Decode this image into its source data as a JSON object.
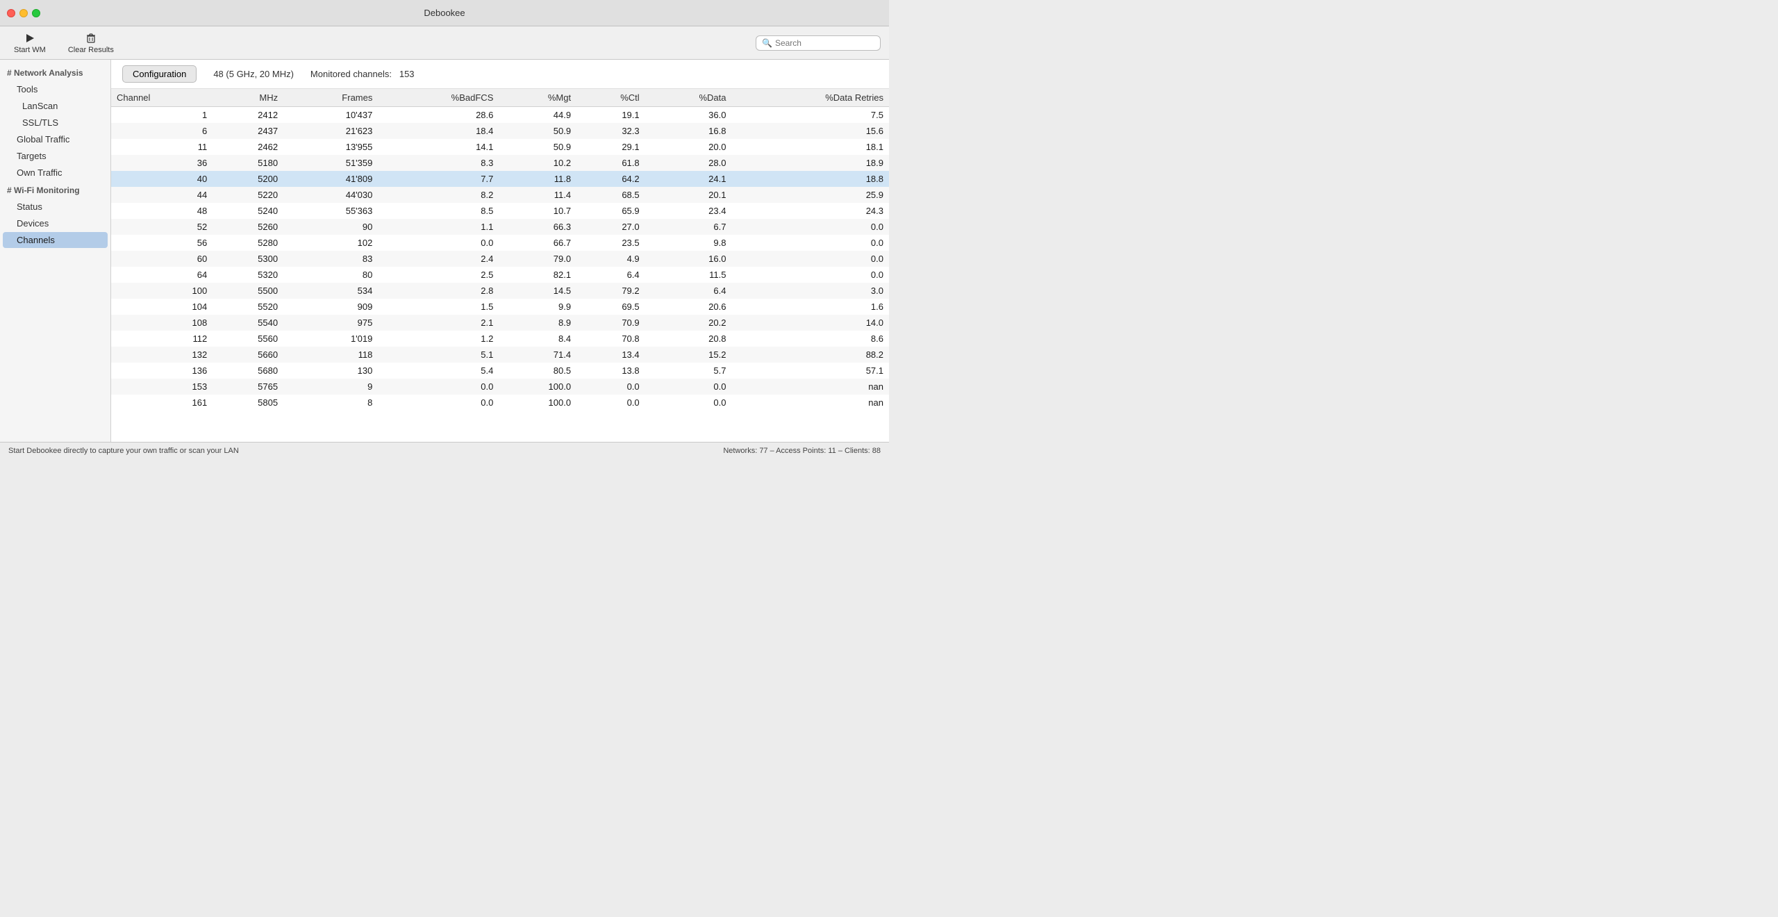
{
  "titlebar": {
    "title": "Debookee"
  },
  "toolbar": {
    "start_wm_label": "Start WM",
    "clear_results_label": "Clear Results",
    "search_placeholder": "Search"
  },
  "sidebar": {
    "network_analysis_header": "# Network Analysis",
    "tools_label": "Tools",
    "lanscan_label": "LanScan",
    "ssltls_label": "SSL/TLS",
    "global_traffic_label": "Global Traffic",
    "targets_label": "Targets",
    "own_traffic_label": "Own Traffic",
    "wifi_monitoring_header": "# Wi-Fi Monitoring",
    "status_label": "Status",
    "devices_label": "Devices",
    "channels_label": "Channels"
  },
  "content": {
    "config_btn": "Configuration",
    "channel_info": "48 (5 GHz, 20 MHz)",
    "monitored_label": "Monitored channels:",
    "monitored_value": "153"
  },
  "table": {
    "headers": [
      "Channel",
      "MHz",
      "Frames",
      "%BadFCS",
      "%Mgt",
      "%Ctl",
      "%Data",
      "%Data Retries"
    ],
    "rows": [
      {
        "channel": 1,
        "mhz": 2412,
        "frames": "10'437",
        "badFCS": "28.6",
        "mgt": "44.9",
        "ctl": "19.1",
        "data": "36.0",
        "dataRetries": "7.5",
        "highlighted": false
      },
      {
        "channel": 6,
        "mhz": 2437,
        "frames": "21'623",
        "badFCS": "18.4",
        "mgt": "50.9",
        "ctl": "32.3",
        "data": "16.8",
        "dataRetries": "15.6",
        "highlighted": false
      },
      {
        "channel": 11,
        "mhz": 2462,
        "frames": "13'955",
        "badFCS": "14.1",
        "mgt": "50.9",
        "ctl": "29.1",
        "data": "20.0",
        "dataRetries": "18.1",
        "highlighted": false
      },
      {
        "channel": 36,
        "mhz": 5180,
        "frames": "51'359",
        "badFCS": "8.3",
        "mgt": "10.2",
        "ctl": "61.8",
        "data": "28.0",
        "dataRetries": "18.9",
        "highlighted": false
      },
      {
        "channel": 40,
        "mhz": 5200,
        "frames": "41'809",
        "badFCS": "7.7",
        "mgt": "11.8",
        "ctl": "64.2",
        "data": "24.1",
        "dataRetries": "18.8",
        "highlighted": true
      },
      {
        "channel": 44,
        "mhz": 5220,
        "frames": "44'030",
        "badFCS": "8.2",
        "mgt": "11.4",
        "ctl": "68.5",
        "data": "20.1",
        "dataRetries": "25.9",
        "highlighted": false
      },
      {
        "channel": 48,
        "mhz": 5240,
        "frames": "55'363",
        "badFCS": "8.5",
        "mgt": "10.7",
        "ctl": "65.9",
        "data": "23.4",
        "dataRetries": "24.3",
        "highlighted": false
      },
      {
        "channel": 52,
        "mhz": 5260,
        "frames": "90",
        "badFCS": "1.1",
        "mgt": "66.3",
        "ctl": "27.0",
        "data": "6.7",
        "dataRetries": "0.0",
        "highlighted": false
      },
      {
        "channel": 56,
        "mhz": 5280,
        "frames": "102",
        "badFCS": "0.0",
        "mgt": "66.7",
        "ctl": "23.5",
        "data": "9.8",
        "dataRetries": "0.0",
        "highlighted": false
      },
      {
        "channel": 60,
        "mhz": 5300,
        "frames": "83",
        "badFCS": "2.4",
        "mgt": "79.0",
        "ctl": "4.9",
        "data": "16.0",
        "dataRetries": "0.0",
        "highlighted": false
      },
      {
        "channel": 64,
        "mhz": 5320,
        "frames": "80",
        "badFCS": "2.5",
        "mgt": "82.1",
        "ctl": "6.4",
        "data": "11.5",
        "dataRetries": "0.0",
        "highlighted": false
      },
      {
        "channel": 100,
        "mhz": 5500,
        "frames": "534",
        "badFCS": "2.8",
        "mgt": "14.5",
        "ctl": "79.2",
        "data": "6.4",
        "dataRetries": "3.0",
        "highlighted": false
      },
      {
        "channel": 104,
        "mhz": 5520,
        "frames": "909",
        "badFCS": "1.5",
        "mgt": "9.9",
        "ctl": "69.5",
        "data": "20.6",
        "dataRetries": "1.6",
        "highlighted": false
      },
      {
        "channel": 108,
        "mhz": 5540,
        "frames": "975",
        "badFCS": "2.1",
        "mgt": "8.9",
        "ctl": "70.9",
        "data": "20.2",
        "dataRetries": "14.0",
        "highlighted": false
      },
      {
        "channel": 112,
        "mhz": 5560,
        "frames": "1'019",
        "badFCS": "1.2",
        "mgt": "8.4",
        "ctl": "70.8",
        "data": "20.8",
        "dataRetries": "8.6",
        "highlighted": false
      },
      {
        "channel": 132,
        "mhz": 5660,
        "frames": "118",
        "badFCS": "5.1",
        "mgt": "71.4",
        "ctl": "13.4",
        "data": "15.2",
        "dataRetries": "88.2",
        "highlighted": false
      },
      {
        "channel": 136,
        "mhz": 5680,
        "frames": "130",
        "badFCS": "5.4",
        "mgt": "80.5",
        "ctl": "13.8",
        "data": "5.7",
        "dataRetries": "57.1",
        "highlighted": false
      },
      {
        "channel": 153,
        "mhz": 5765,
        "frames": "9",
        "badFCS": "0.0",
        "mgt": "100.0",
        "ctl": "0.0",
        "data": "0.0",
        "dataRetries": "nan",
        "highlighted": false
      },
      {
        "channel": 161,
        "mhz": 5805,
        "frames": "8",
        "badFCS": "0.0",
        "mgt": "100.0",
        "ctl": "0.0",
        "data": "0.0",
        "dataRetries": "nan",
        "highlighted": false
      }
    ]
  },
  "statusbar": {
    "left_text": "Start Debookee directly to capture your own traffic or scan your LAN",
    "right_text": "Networks: 77 – Access Points: 11 – Clients: 88"
  }
}
